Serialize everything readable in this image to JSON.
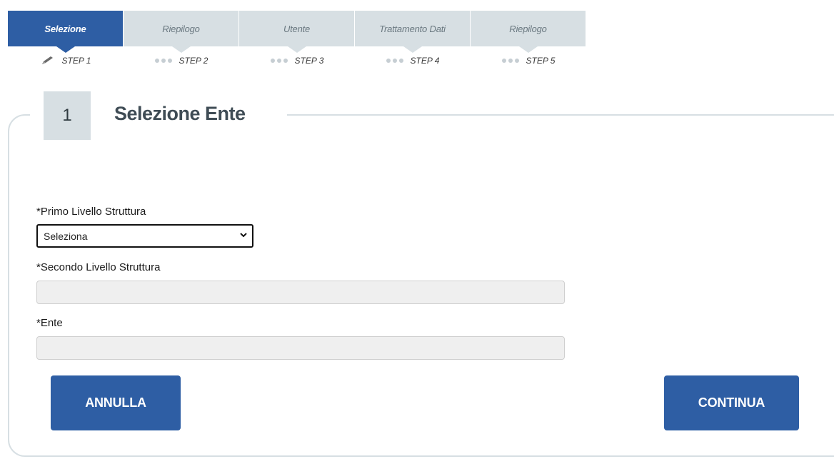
{
  "stepper": {
    "tabs": [
      {
        "label": "Selezione",
        "active": true
      },
      {
        "label": "Riepilogo",
        "active": false
      },
      {
        "label": "Utente",
        "active": false
      },
      {
        "label": "Trattamento Dati",
        "active": false
      },
      {
        "label": "Riepilogo",
        "active": false
      }
    ],
    "steps": [
      {
        "label": "STEP 1",
        "icon": "pencil-icon"
      },
      {
        "label": "STEP 2",
        "icon": "dots-icon"
      },
      {
        "label": "STEP 3",
        "icon": "dots-icon"
      },
      {
        "label": "STEP 4",
        "icon": "dots-icon"
      },
      {
        "label": "STEP 5",
        "icon": "dots-icon"
      }
    ]
  },
  "section": {
    "number": "1",
    "title": "Selezione Ente"
  },
  "form": {
    "primo_label": "*Primo Livello Struttura",
    "primo_value": "Seleziona",
    "secondo_label": "*Secondo Livello Struttura",
    "ente_label": "*Ente"
  },
  "buttons": {
    "annulla": "ANNULLA",
    "continua": "CONTINUA"
  },
  "colors": {
    "primary": "#2e5ea4",
    "tab_inactive": "#d7dfe3"
  }
}
